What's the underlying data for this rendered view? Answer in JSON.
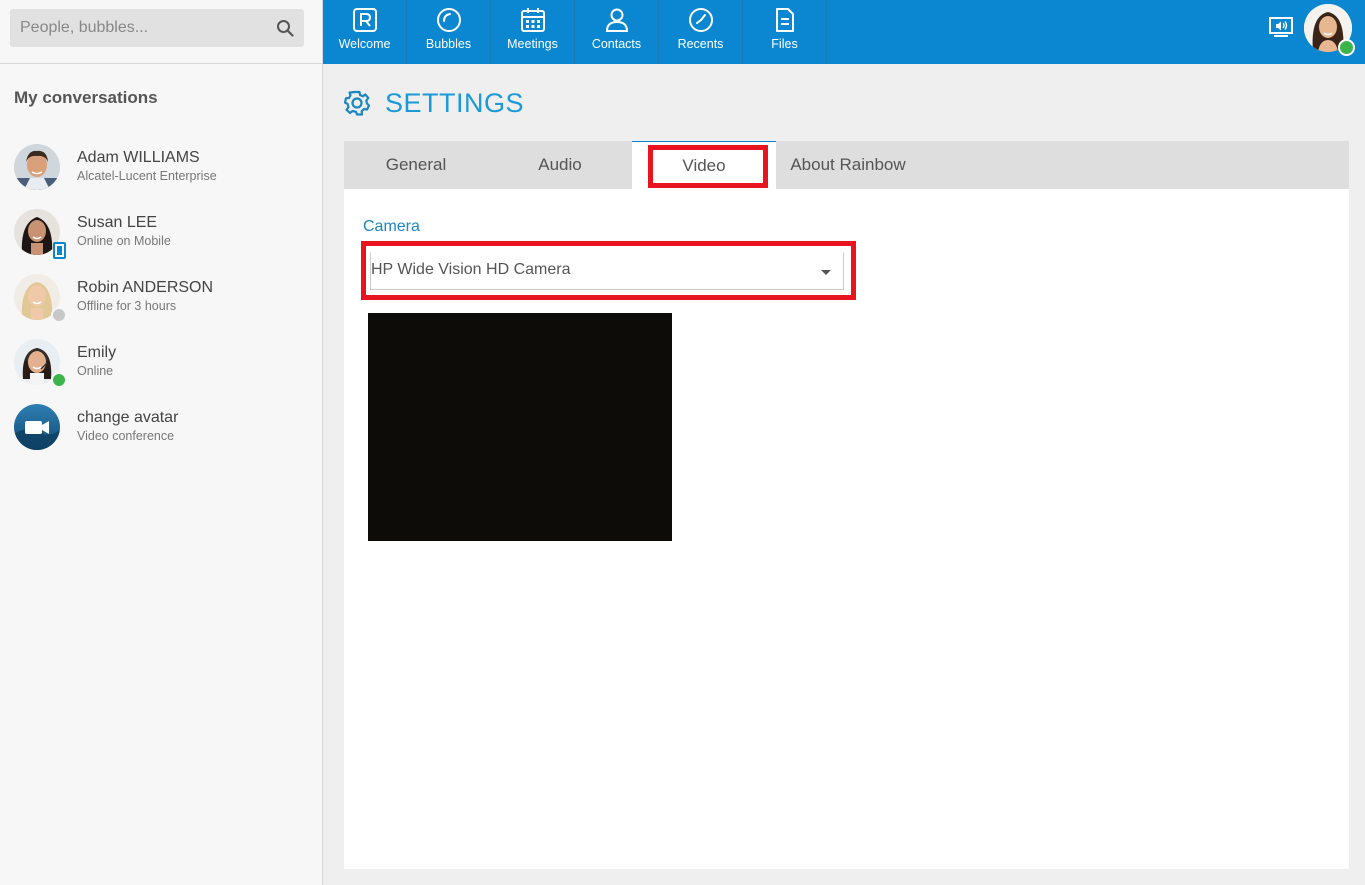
{
  "search": {
    "placeholder": "People, bubbles..."
  },
  "sidebar": {
    "title": "My conversations",
    "conversations": [
      {
        "name": "Adam WILLIAMS",
        "subtitle": "Alcatel-Lucent Enterprise",
        "status": "none"
      },
      {
        "name": "Susan LEE",
        "subtitle": "Online on Mobile",
        "status": "mobile"
      },
      {
        "name": "Robin ANDERSON",
        "subtitle": "Offline for 3 hours",
        "status": "offline"
      },
      {
        "name": "Emily",
        "subtitle": "Online",
        "status": "online"
      },
      {
        "name": "change avatar",
        "subtitle": "Video conference",
        "status": "video"
      }
    ]
  },
  "nav": {
    "items": [
      {
        "label": "Welcome",
        "icon": "rainbow-r-icon"
      },
      {
        "label": "Bubbles",
        "icon": "bubbles-icon"
      },
      {
        "label": "Meetings",
        "icon": "calendar-icon"
      },
      {
        "label": "Contacts",
        "icon": "person-icon"
      },
      {
        "label": "Recents",
        "icon": "clock-icon"
      },
      {
        "label": "Files",
        "icon": "file-icon"
      }
    ]
  },
  "settings": {
    "title": "SETTINGS",
    "tabs": [
      {
        "label": "General",
        "active": false
      },
      {
        "label": "Audio",
        "active": false
      },
      {
        "label": "Video",
        "active": true
      },
      {
        "label": "About Rainbow",
        "active": false
      }
    ],
    "camera_label": "Camera",
    "camera_selected": "HP Wide Vision HD Camera"
  },
  "colors": {
    "brand_blue": "#0a87d0",
    "title_blue": "#1a9ad6",
    "highlight_red": "#e8141f",
    "online_green": "#3bb54a",
    "offline_gray": "#c8c8c8"
  }
}
